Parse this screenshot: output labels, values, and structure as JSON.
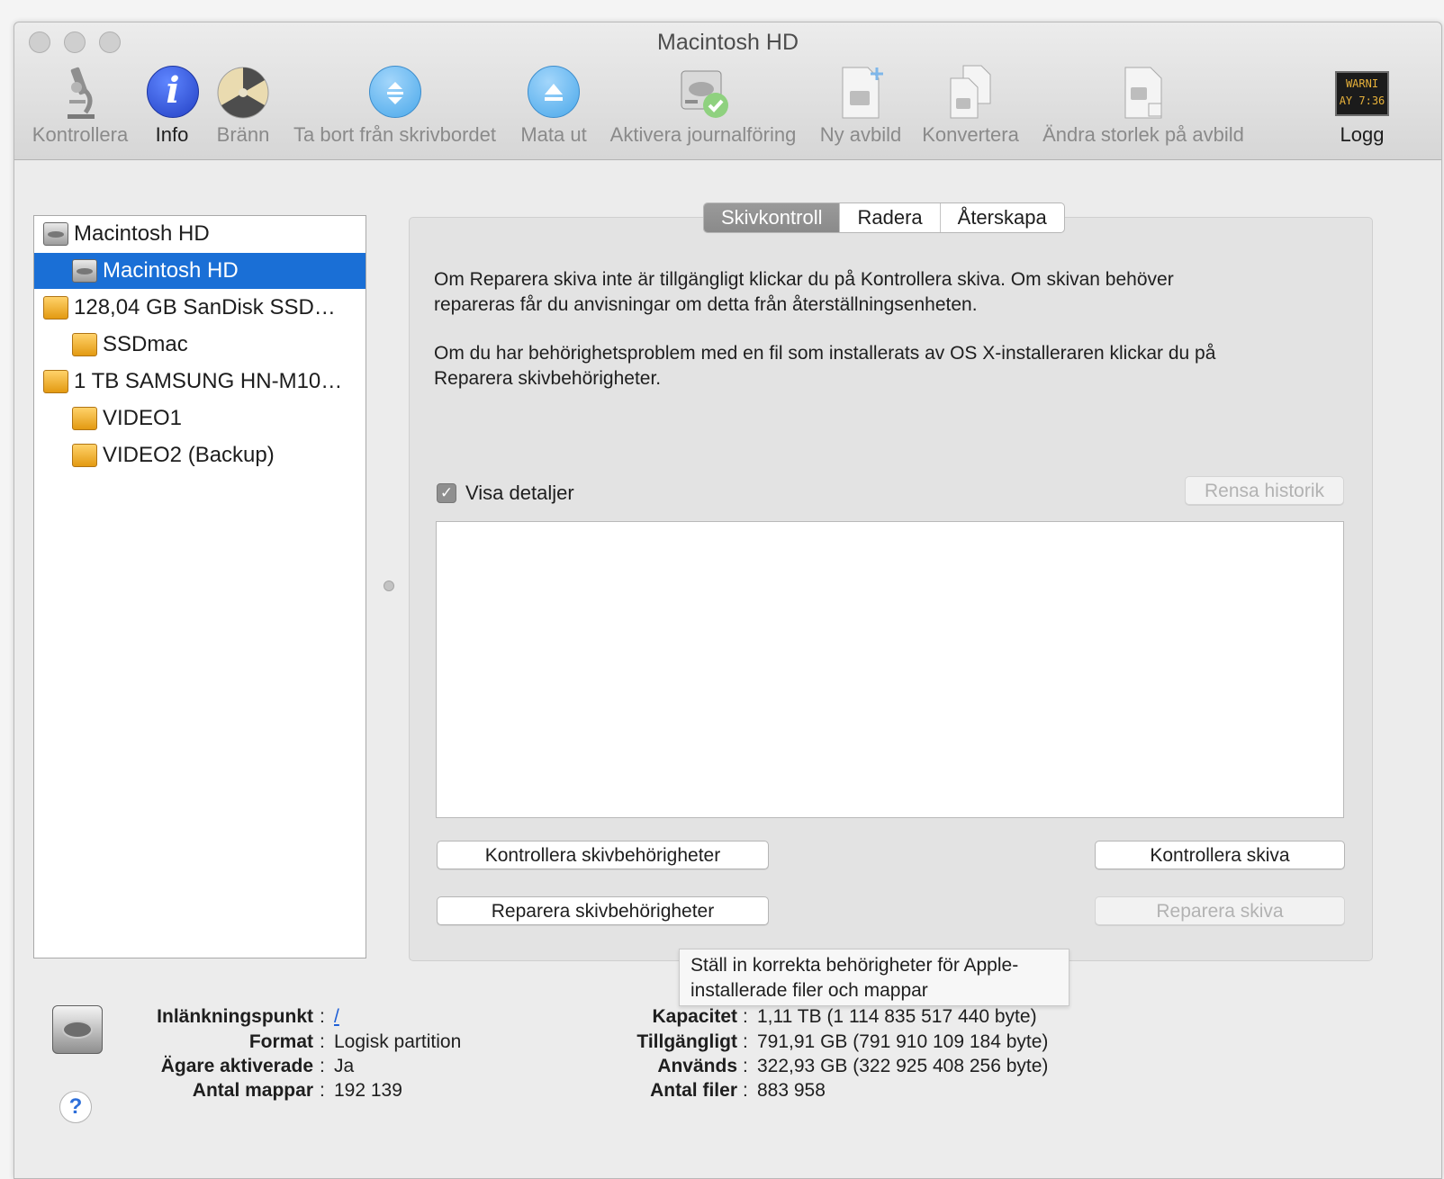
{
  "window": {
    "title": "Macintosh HD"
  },
  "toolbar": {
    "verify": "Kontrollera",
    "info": "Info",
    "burn": "Bränn",
    "unmount": "Ta bort från skrivbordet",
    "eject": "Mata ut",
    "journal": "Aktivera journalföring",
    "new_image": "Ny avbild",
    "convert": "Konvertera",
    "resize": "Ändra storlek på avbild",
    "log": "Logg",
    "log_icon_text": "WARNI\nAY 7:36"
  },
  "sidebar": {
    "items": [
      {
        "label": "Macintosh HD",
        "icon": "internal-disk-icon"
      },
      {
        "label": "Macintosh HD",
        "icon": "internal-volume-icon",
        "selected": true
      },
      {
        "label": "128,04 GB SanDisk SSD…",
        "icon": "external-disk-icon"
      },
      {
        "label": "SSDmac",
        "icon": "external-volume-icon"
      },
      {
        "label": "1 TB SAMSUNG HN-M10…",
        "icon": "external-disk-icon"
      },
      {
        "label": "VIDEO1",
        "icon": "external-volume-icon"
      },
      {
        "label": "VIDEO2 (Backup)",
        "icon": "external-volume-icon"
      }
    ]
  },
  "tabs": [
    "Skivkontroll",
    "Radera",
    "Återskapa"
  ],
  "first_aid": {
    "para1_line1": "Om Reparera skiva inte är tillgängligt klickar du på Kontrollera skiva. Om skivan behöver",
    "para1_line2": "repareras får du anvisningar om detta från återställningsenheten.",
    "para2_line1": "Om du har behörighetsproblem med en fil som installerats av OS X-installeraren klickar du på",
    "para2_line2": "Reparera skivbehörigheter.",
    "show_details": "Visa detaljer",
    "show_details_checked": true,
    "clear_history": "Rensa historik",
    "verify_permissions": "Kontrollera skivbehörigheter",
    "repair_permissions": "Reparera skivbehörigheter",
    "verify_disk": "Kontrollera skiva",
    "repair_disk": "Reparera skiva"
  },
  "tooltip": {
    "line1": "Ställ in korrekta behörigheter för Apple-",
    "line2": "installerade filer och mappar"
  },
  "info_left": [
    {
      "key": "Inlänkningspunkt",
      "value": "/"
    },
    {
      "key": "Format",
      "value": "Logisk partition"
    },
    {
      "key": "Ägare aktiverade",
      "value": "Ja"
    },
    {
      "key": "Antal mappar",
      "value": "192 139"
    }
  ],
  "info_right": [
    {
      "key": "Kapacitet",
      "value": "1,11 TB (1 114 835 517 440 byte)"
    },
    {
      "key": "Tillgängligt",
      "value": "791,91 GB (791 910 109 184 byte)"
    },
    {
      "key": "Används",
      "value": "322,93 GB (322 925 408 256 byte)"
    },
    {
      "key": "Antal filer",
      "value": "883 958"
    }
  ],
  "colon": ":",
  "help_glyph": "?",
  "check_glyph": "✓",
  "colors": {
    "selection": "#1a6fd6",
    "info_icon": "#2b55d6",
    "eject_icon": "#4aa8ea"
  }
}
